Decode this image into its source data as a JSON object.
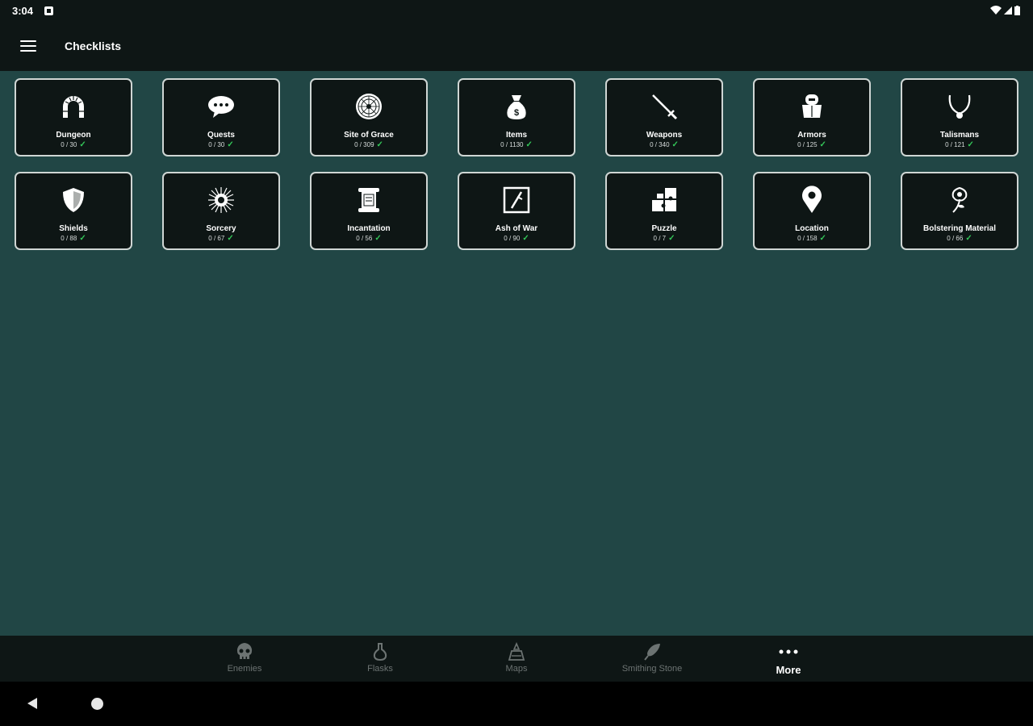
{
  "status_bar": {
    "time": "3:04"
  },
  "app_bar": {
    "title": "Checklists"
  },
  "tiles": [
    {
      "label": "Dungeon",
      "count": "0 / 30",
      "icon": "archway-icon"
    },
    {
      "label": "Quests",
      "count": "0 / 30",
      "icon": "speech-bubble-icon"
    },
    {
      "label": "Site of Grace",
      "count": "0 / 309",
      "icon": "grace-circle-icon"
    },
    {
      "label": "Items",
      "count": "0 / 1130",
      "icon": "money-bag-icon"
    },
    {
      "label": "Weapons",
      "count": "0 / 340",
      "icon": "sword-icon"
    },
    {
      "label": "Armors",
      "count": "0 / 125",
      "icon": "armor-icon"
    },
    {
      "label": "Talismans",
      "count": "0 / 121",
      "icon": "necklace-icon"
    },
    {
      "label": "Shields",
      "count": "0 / 88",
      "icon": "shield-icon"
    },
    {
      "label": "Sorcery",
      "count": "0 / 67",
      "icon": "sorcery-burst-icon"
    },
    {
      "label": "Incantation",
      "count": "0 / 56",
      "icon": "scroll-icon"
    },
    {
      "label": "Ash of War",
      "count": "0 / 90",
      "icon": "ash-of-war-icon"
    },
    {
      "label": "Puzzle",
      "count": "0 / 7",
      "icon": "puzzle-icon"
    },
    {
      "label": "Location",
      "count": "0 / 158",
      "icon": "map-pin-icon"
    },
    {
      "label": "Bolstering Material",
      "count": "0 / 66",
      "icon": "flower-icon"
    }
  ],
  "check_mark": "✓",
  "bottom_nav": [
    {
      "label": "Enemies",
      "icon": "skull-icon",
      "active": false
    },
    {
      "label": "Flasks",
      "icon": "flask-icon",
      "active": false
    },
    {
      "label": "Maps",
      "icon": "map-icon",
      "active": false
    },
    {
      "label": "Smithing Stone",
      "icon": "smithing-stone-icon",
      "active": false
    },
    {
      "label": "More",
      "icon": "more-dots-icon",
      "active": true
    }
  ],
  "colors": {
    "background": "#214645",
    "bar": "#0e1615",
    "tile_border": "#cfd6d4",
    "check": "#34c759",
    "inactive_nav": "#6c7372"
  }
}
